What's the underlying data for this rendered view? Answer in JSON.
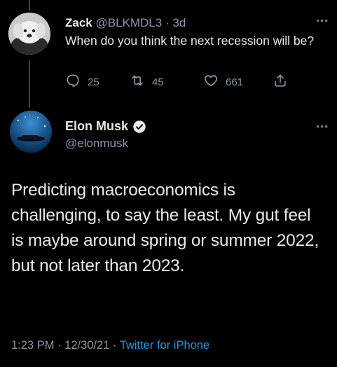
{
  "reply_tweet": {
    "author_name": "Zack",
    "author_handle": "@BLKMDL3",
    "separator": "·",
    "time_ago": "3d",
    "text": "When do you think the next recession will be?",
    "reply_count": "25",
    "retweet_count": "45",
    "like_count": "661"
  },
  "main_tweet": {
    "author_name": "Elon Musk",
    "author_handle": "@elonmusk",
    "text": "Predicting macroeconomics is challenging, to say the least. My gut feel is maybe around spring or summer 2022, but not later than 2023.",
    "time": "1:23 PM",
    "date": "12/30/21",
    "separator": "·",
    "source": "Twitter for iPhone"
  },
  "icons": {
    "more": "more-icon",
    "reply": "reply-icon",
    "retweet": "retweet-icon",
    "like": "heart-icon",
    "share": "share-icon",
    "verified": "verified-badge-icon"
  },
  "colors": {
    "background": "#000000",
    "text": "#e7e9ea",
    "secondary": "#8b98a5",
    "link": "#1d9bf0"
  }
}
